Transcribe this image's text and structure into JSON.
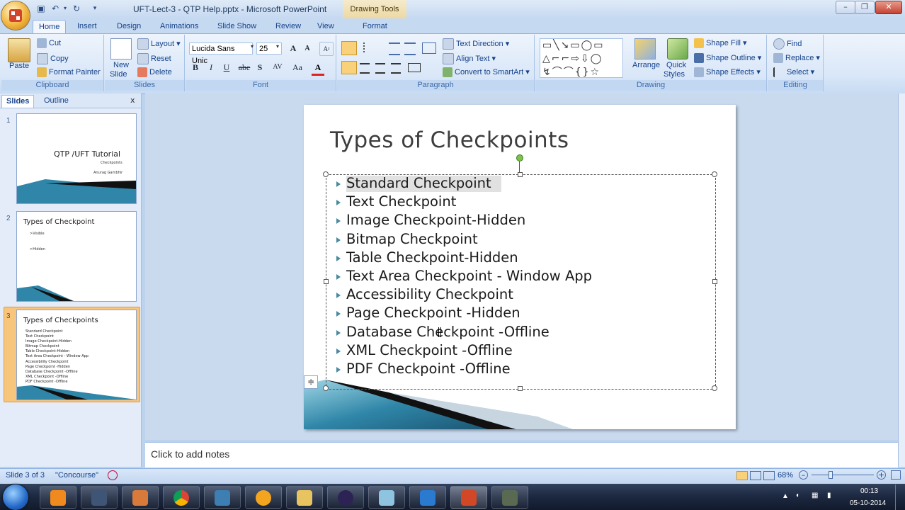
{
  "window": {
    "title": "UFT-Lect-3 - QTP Help.pptx - Microsoft PowerPoint",
    "context_tools": "Drawing Tools"
  },
  "tabs": [
    "Home",
    "Insert",
    "Design",
    "Animations",
    "Slide Show",
    "Review",
    "View",
    "Format"
  ],
  "ribbon": {
    "clipboard": {
      "paste": "Paste",
      "cut": "Cut",
      "copy": "Copy",
      "format_painter": "Format Painter",
      "label": "Clipboard"
    },
    "slides": {
      "new_slide_1": "New",
      "new_slide_2": "Slide",
      "layout": "Layout",
      "reset": "Reset",
      "delete": "Delete",
      "label": "Slides"
    },
    "font": {
      "family": "Lucida Sans Unic",
      "size": "25",
      "label": "Font",
      "bold": "B",
      "italic": "I",
      "underline": "U",
      "strike": "abe",
      "shadow": "S",
      "spacing": "AV",
      "case": "Aa",
      "color": "A",
      "grow": "A",
      "shrink": "A"
    },
    "paragraph": {
      "text_direction": "Text Direction",
      "align_text": "Align Text",
      "convert_smartart": "Convert to SmartArt",
      "label": "Paragraph"
    },
    "drawing": {
      "arrange": "Arrange",
      "quick_styles_1": "Quick",
      "quick_styles_2": "Styles",
      "shape_fill": "Shape Fill",
      "shape_outline": "Shape Outline",
      "shape_effects": "Shape Effects",
      "label": "Drawing"
    },
    "editing": {
      "find": "Find",
      "replace": "Replace",
      "select": "Select",
      "label": "Editing"
    }
  },
  "left_panel": {
    "tabs": [
      "Slides",
      "Outline"
    ],
    "close": "x",
    "thumbs": [
      {
        "num": "1",
        "title": "QTP /UFT Tutorial",
        "sub1": "Checkpoints",
        "sub2": "Anurag Gambhir"
      },
      {
        "num": "2",
        "title": "Types of Checkpoint",
        "items": [
          ">Visible",
          ">Hidden"
        ]
      },
      {
        "num": "3",
        "title": "Types of Checkpoints",
        "items": [
          "Standard Checkpoint",
          "Text Checkpoint",
          "Image Checkpoint-Hidden",
          "Bitmap Checkpoint",
          "Table Checkpoint-Hidden",
          "Text Area Checkpoint - Window App",
          "Accessibility Checkpoint",
          "Page Checkpoint -Hidden",
          "Database Checkpoint -Offline",
          "XML Checkpoint -Offline",
          "PDF Checkpoint -Offline"
        ]
      }
    ]
  },
  "slide": {
    "title": "Types of Checkpoints",
    "bullets": [
      "Standard Checkpoint",
      "Text Checkpoint",
      "Image Checkpoint-Hidden",
      "Bitmap Checkpoint",
      "Table Checkpoint-Hidden",
      "Text Area Checkpoint - Window App",
      "Accessibility Checkpoint",
      "Page Checkpoint -Hidden",
      "Database Checkpoint -Offline",
      "XML Checkpoint -Offline",
      "PDF Checkpoint -Offline"
    ]
  },
  "notes": {
    "placeholder": "Click to add notes"
  },
  "status": {
    "slide": "Slide 3 of 3",
    "theme": "\"Concourse\"",
    "zoom": "68%"
  },
  "tray": {
    "time": "00:13",
    "date": "05-10-2014"
  },
  "colors": {
    "accent": "#2f86a8",
    "selection": "#f6b35a",
    "ribbon": "#dbe7f6"
  }
}
